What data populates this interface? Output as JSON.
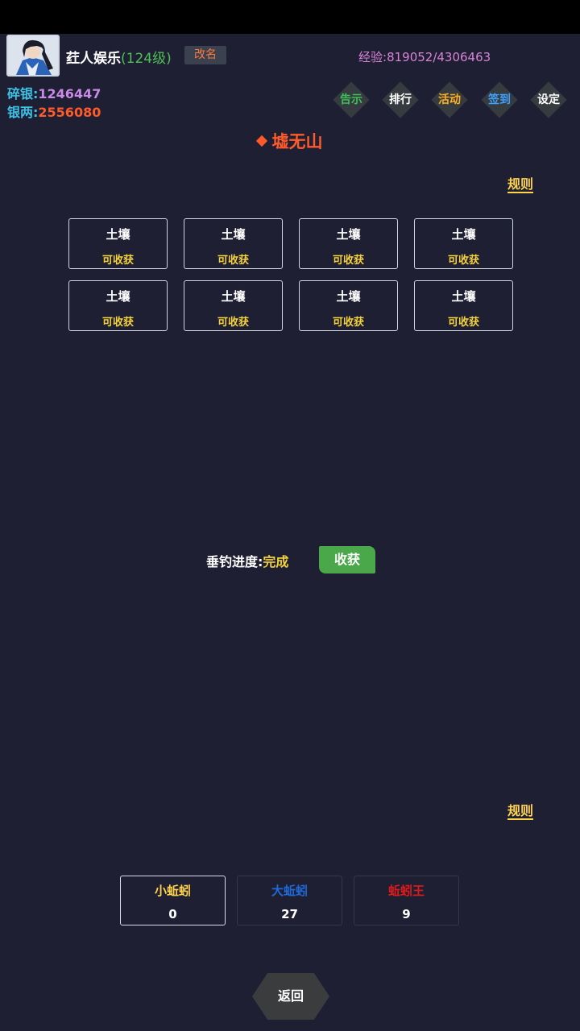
{
  "header": {
    "name": "荭人娱乐",
    "level": "(124级)",
    "rename_label": "改名",
    "exp_label": "经验:",
    "exp_value": "819052/4306463",
    "silver_pieces_label": "碎银:",
    "silver_pieces_value": "1246447",
    "silver_taels_label": "银两:",
    "silver_taels_value": "2556080"
  },
  "menu": [
    {
      "label": "告示",
      "color": "#3fbf5a"
    },
    {
      "label": "排行",
      "color": "#ffffff"
    },
    {
      "label": "活动",
      "color": "#ffb020"
    },
    {
      "label": "签到",
      "color": "#3fa0ff"
    },
    {
      "label": "设定",
      "color": "#ffffff"
    }
  ],
  "area_title": "墟无山",
  "rules_label": "规则",
  "plots": [
    {
      "name": "土壤",
      "state": "可收获"
    },
    {
      "name": "土壤",
      "state": "可收获"
    },
    {
      "name": "土壤",
      "state": "可收获"
    },
    {
      "name": "土壤",
      "state": "可收获"
    },
    {
      "name": "土壤",
      "state": "可收获"
    },
    {
      "name": "土壤",
      "state": "可收获"
    },
    {
      "name": "土壤",
      "state": "可收获"
    },
    {
      "name": "土壤",
      "state": "可收获"
    }
  ],
  "fishing": {
    "progress_label": "垂钓进度:",
    "progress_value": "完成",
    "harvest_label": "收获"
  },
  "baits": [
    {
      "name": "小蚯蚓",
      "count": "0",
      "color": "#ffd44a",
      "selected": true
    },
    {
      "name": "大蚯蚓",
      "count": "27",
      "color": "#1f6ad8",
      "selected": false
    },
    {
      "name": "蚯蚓王",
      "count": "9",
      "color": "#e01a1a",
      "selected": false
    }
  ],
  "back_label": "返回",
  "colors": {
    "background": "#1f1f33",
    "accent": "#ff5a2a",
    "gold": "#f4d23c",
    "green_button": "#4aa84a"
  }
}
